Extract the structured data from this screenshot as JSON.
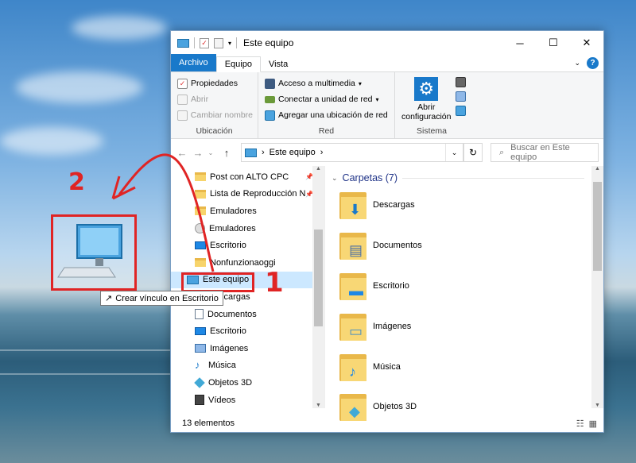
{
  "window": {
    "title": "Este equipo",
    "controls": {
      "minimize": "─",
      "maximize": "☐",
      "close": "✕"
    }
  },
  "ribbon_tabs": [
    "Archivo",
    "Equipo",
    "Vista"
  ],
  "ribbon": {
    "ubicacion": {
      "label": "Ubicación",
      "items": [
        "Propiedades",
        "Abrir",
        "Cambiar nombre"
      ]
    },
    "red": {
      "label": "Red",
      "items": [
        "Acceso a multimedia",
        "Conectar a unidad de red",
        "Agregar una ubicación de red"
      ]
    },
    "sistema": {
      "label": "Sistema",
      "open_config": [
        "Abrir",
        "configuración"
      ]
    }
  },
  "address_bar": {
    "path": "Este equipo",
    "chevron": "›"
  },
  "search": {
    "placeholder": "Buscar en Este equipo"
  },
  "nav_pane": [
    {
      "label": "Post con ALTO CPC",
      "icon": "folder-icon",
      "pinned": true
    },
    {
      "label": "Lista de Reproducción N",
      "icon": "folder-icon",
      "pinned": true
    },
    {
      "label": "Emuladores",
      "icon": "folder-icon",
      "pinned": false
    },
    {
      "label": "Emuladores",
      "icon": "disc-icon",
      "pinned": false
    },
    {
      "label": "Escritorio",
      "icon": "desktop-icon",
      "pinned": false
    },
    {
      "label": "Nonfunzionaoggi",
      "icon": "folder-icon",
      "pinned": false
    },
    {
      "label": "Este equipo",
      "icon": "computer-icon",
      "pinned": false,
      "selected": true
    },
    {
      "label": "Descargas",
      "icon": "download-icon",
      "pinned": false
    },
    {
      "label": "Documentos",
      "icon": "document-icon",
      "pinned": false
    },
    {
      "label": "Escritorio",
      "icon": "desktop-icon",
      "pinned": false
    },
    {
      "label": "Imágenes",
      "icon": "image-icon",
      "pinned": false
    },
    {
      "label": "Música",
      "icon": "music-icon",
      "pinned": false
    },
    {
      "label": "Objetos 3D",
      "icon": "cube-icon",
      "pinned": false
    },
    {
      "label": "Vídeos",
      "icon": "film-icon",
      "pinned": false
    }
  ],
  "content": {
    "group_title": "Carpetas (7)",
    "folders": [
      {
        "label": "Descargas",
        "overlay": "⬇",
        "color": "#1979ca"
      },
      {
        "label": "Documentos",
        "overlay": "▤",
        "color": "#4a6fa5"
      },
      {
        "label": "Escritorio",
        "overlay": "▬",
        "color": "#1e88e5"
      },
      {
        "label": "Imágenes",
        "overlay": "▭",
        "color": "#4a90c2"
      },
      {
        "label": "Música",
        "overlay": "♪",
        "color": "#1e88e5"
      },
      {
        "label": "Objetos 3D",
        "overlay": "◆",
        "color": "#41a9d6"
      }
    ]
  },
  "status": {
    "item_count": "13 elementos"
  },
  "annotations": {
    "tooltip": "Crear vínculo en Escritorio",
    "number_1": "1",
    "number_2": "2",
    "color": "#e02424"
  }
}
